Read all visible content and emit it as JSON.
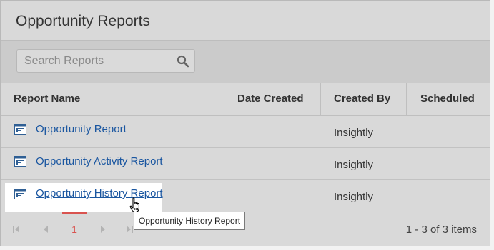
{
  "page": {
    "title": "Opportunity Reports"
  },
  "search": {
    "placeholder": "Search Reports"
  },
  "columns": [
    "Report Name",
    "Date Created",
    "Created By",
    "Scheduled"
  ],
  "rows": [
    {
      "name": "Opportunity Report",
      "date_created": "",
      "created_by": "Insightly",
      "scheduled": ""
    },
    {
      "name": "Opportunity Activity Report",
      "date_created": "",
      "created_by": "Insightly",
      "scheduled": ""
    },
    {
      "name": "Opportunity History Report",
      "date_created": "",
      "created_by": "Insightly",
      "scheduled": ""
    }
  ],
  "pagination": {
    "current_page": "1",
    "info": "1 - 3 of 3 items"
  },
  "tooltip": {
    "text": "Opportunity History Report"
  },
  "colors": {
    "link": "#1a56a0",
    "accent": "#d9534f",
    "panel": "#d9d9d9"
  }
}
